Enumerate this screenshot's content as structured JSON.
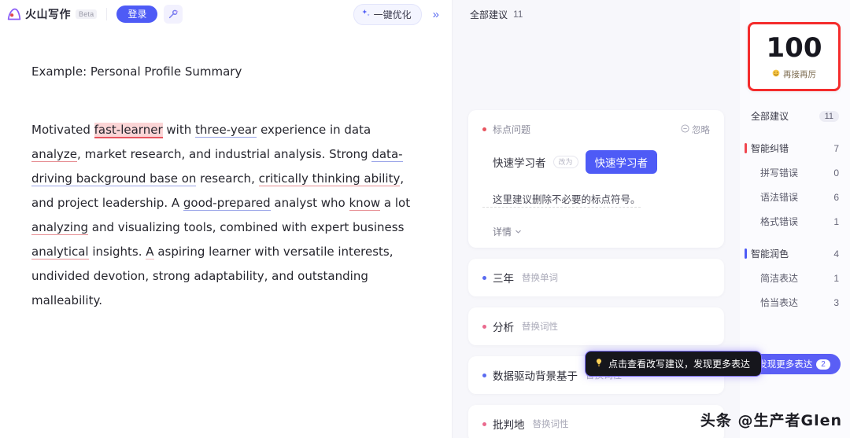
{
  "header": {
    "logo_text": "火山写作",
    "beta_label": "Beta",
    "login_label": "登录",
    "magic_icon": "magic-wand-icon",
    "optimize_label": "一键优化",
    "optimize_icon": "sparkle-icon",
    "collapse_icon": "»"
  },
  "document": {
    "title": "Example: Personal Profile Summary",
    "body_segments": [
      {
        "text": "Motivated ",
        "mark": "none"
      },
      {
        "text": "fast-learner",
        "mark": "highlight-red"
      },
      {
        "text": " with ",
        "mark": "none"
      },
      {
        "text": "three-year",
        "mark": "underline-blue"
      },
      {
        "text": " experience in data ",
        "mark": "none"
      },
      {
        "text": "analyze",
        "mark": "underline-red"
      },
      {
        "text": ", market research, and industrial analysis. Strong ",
        "mark": "none"
      },
      {
        "text": "data-driving background base on",
        "mark": "underline-blue"
      },
      {
        "text": " research, ",
        "mark": "none"
      },
      {
        "text": "critically thinking ability",
        "mark": "underline-red"
      },
      {
        "text": ", and project leadership. A ",
        "mark": "none"
      },
      {
        "text": "good-prepared",
        "mark": "underline-blue"
      },
      {
        "text": " analyst who ",
        "mark": "none"
      },
      {
        "text": "know",
        "mark": "underline-red"
      },
      {
        "text": " a lot ",
        "mark": "none"
      },
      {
        "text": "analyzing",
        "mark": "underline-red"
      },
      {
        "text": " and visualizing tools, combined with expert business ",
        "mark": "none"
      },
      {
        "text": "analytical",
        "mark": "underline-red"
      },
      {
        "text": " insights. ",
        "mark": "none"
      },
      {
        "text": "A",
        "mark": "underline-red-light"
      },
      {
        "text": " aspiring learner with versatile interests, undivided devotion, strong adaptability, and outstanding malleability.",
        "mark": "none"
      }
    ]
  },
  "suggestions_panel": {
    "header_label": "全部建议",
    "header_count": "11",
    "card": {
      "type_label": "标点问题",
      "type_dot": "red",
      "ignore_label": "忽略",
      "ignore_icon": "minus-circle-icon",
      "original": "快速学习者",
      "arrow_label": "改为",
      "suggestion": "快速学习者",
      "description": "这里建议删除不必要的标点符号。",
      "detail_label": "详情",
      "detail_icon": "chevron-down-icon"
    },
    "items": [
      {
        "word": "三年",
        "tag": "替换单词",
        "dot": "blue"
      },
      {
        "word": "分析",
        "tag": "替换词性",
        "dot": "pink"
      },
      {
        "word": "数据驱动背景基于",
        "tag": "替换词性",
        "dot": "blue"
      },
      {
        "word": "批判地",
        "tag": "替换词性",
        "dot": "pink"
      }
    ],
    "tooltip": {
      "icon": "lightbulb-icon",
      "text": "点击查看改写建议，发现更多表达"
    }
  },
  "score_panel": {
    "score": "100",
    "score_caption": "再接再厉",
    "score_emoji": "smile-emoji",
    "categories": [
      {
        "name": "全部建议",
        "count": "11",
        "bar": "none",
        "level": "top",
        "pill": true
      },
      {
        "name": "智能纠错",
        "count": "7",
        "bar": "red",
        "level": "top",
        "pill": false
      },
      {
        "name": "拼写错误",
        "count": "0",
        "bar": "none",
        "level": "sub",
        "pill": false
      },
      {
        "name": "语法错误",
        "count": "6",
        "bar": "none",
        "level": "sub",
        "pill": false
      },
      {
        "name": "格式错误",
        "count": "1",
        "bar": "none",
        "level": "sub",
        "pill": false
      },
      {
        "name": "智能润色",
        "count": "4",
        "bar": "blue",
        "level": "top",
        "pill": false
      },
      {
        "name": "简洁表达",
        "count": "1",
        "bar": "none",
        "level": "sub",
        "pill": false
      },
      {
        "name": "恰当表达",
        "count": "3",
        "bar": "none",
        "level": "sub",
        "pill": false
      }
    ],
    "more_button_label": "发现更多表达",
    "more_button_badge": "2"
  },
  "watermark": "头条 @生产者Glen",
  "colors": {
    "accent_blue": "#4e5bf6",
    "error_red": "#e8555f",
    "score_border": "#f42c2c",
    "panel_bg": "#f7f7fb"
  }
}
